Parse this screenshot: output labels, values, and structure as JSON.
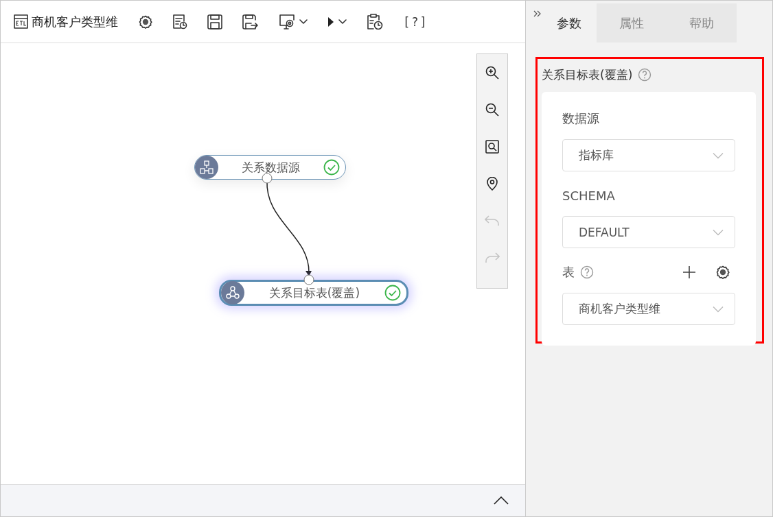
{
  "toolbar": {
    "title": "商机客户类型维",
    "help_label": "[?]"
  },
  "canvas": {
    "nodes": [
      {
        "kind": "source",
        "label": "关系数据源",
        "selected": false,
        "valid": true
      },
      {
        "kind": "target",
        "label": "关系目标表(覆盖)",
        "selected": true,
        "valid": true
      }
    ]
  },
  "zoom_tools": [
    {
      "kind": "zoom-in",
      "disabled": false
    },
    {
      "kind": "zoom-out",
      "disabled": false
    },
    {
      "kind": "fit",
      "disabled": false
    },
    {
      "kind": "locate",
      "disabled": false
    },
    {
      "kind": "undo",
      "disabled": true
    },
    {
      "kind": "redo",
      "disabled": true
    }
  ],
  "panel": {
    "tabs": [
      {
        "label": "参数",
        "selected": true
      },
      {
        "label": "属性",
        "selected": false
      },
      {
        "label": "帮助",
        "selected": false
      }
    ],
    "section_title": "关系目标表(覆盖)",
    "fields": [
      {
        "label": "数据源",
        "value": "指标库",
        "help": false,
        "tools": false
      },
      {
        "label": "SCHEMA",
        "value": "DEFAULT",
        "help": false,
        "tools": false
      },
      {
        "label": "表",
        "value": "商机客户类型维",
        "help": true,
        "tools": true
      }
    ]
  }
}
